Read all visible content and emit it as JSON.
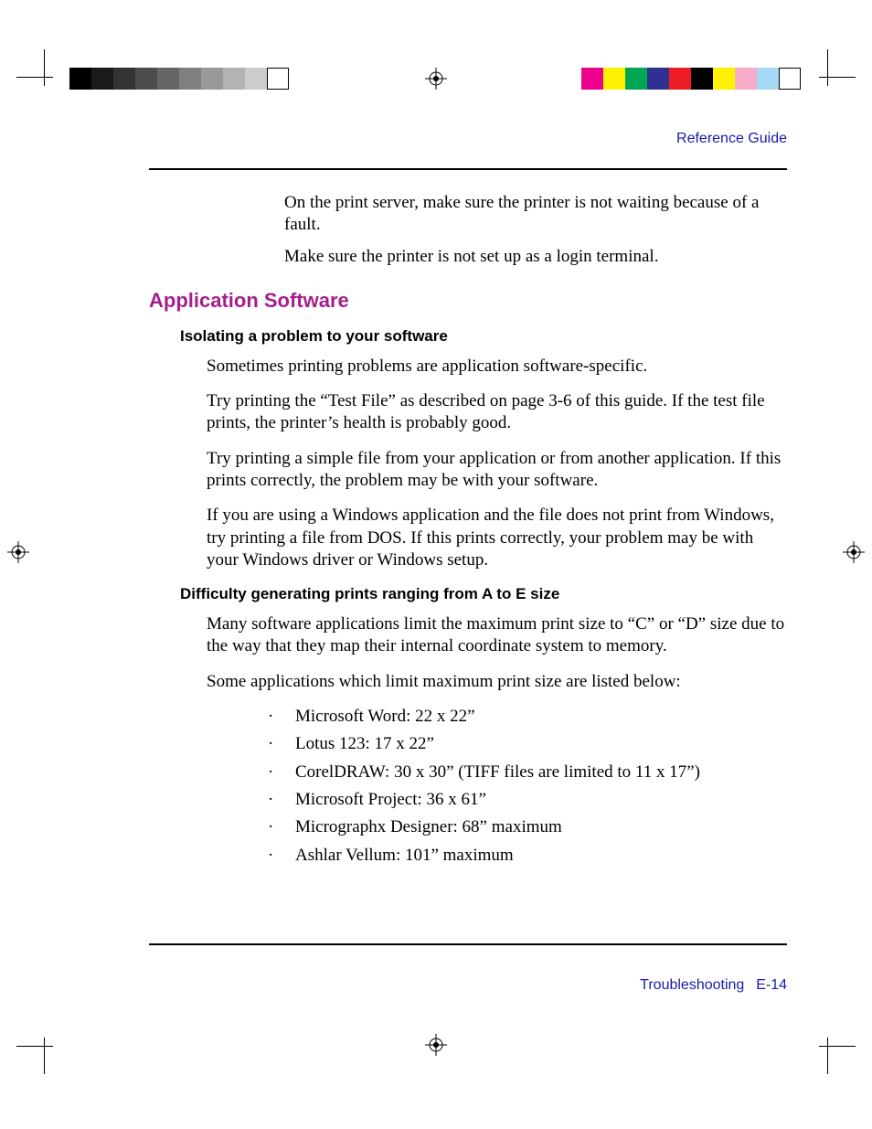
{
  "header": {
    "link": "Reference Guide"
  },
  "footer": {
    "section": "Troubleshooting",
    "page": "E-14"
  },
  "intro": {
    "line1": "On the print server, make sure the printer is not waiting because of a fault.",
    "line2": "Make sure the printer is not set up as a login terminal."
  },
  "section": {
    "title": "Application Software",
    "sub1": {
      "title": "Isolating a problem to your software",
      "p1": "Sometimes printing problems are application software-specific.",
      "p2": "Try printing the “Test File” as described on page 3-6 of this guide. If the test file prints, the printer’s health is probably good.",
      "p3": "Try printing a simple file from your application or from another application. If this prints correctly, the problem may be with your software.",
      "p4": "If you are using a Windows application and the file does not print from Windows, try printing a file from DOS. If this prints correctly, your problem may be with your Windows driver or Windows setup."
    },
    "sub2": {
      "title": "Difficulty generating prints ranging from A to E size",
      "p1": "Many software applications limit the maximum print size to “C” or “D” size due to the way that they map their internal coordinate system to memory.",
      "p2": "Some applications which limit maximum print size are listed below:",
      "items": [
        "Microsoft Word: 22 x 22”",
        "Lotus 123: 17 x 22”",
        "CorelDRAW: 30 x 30” (TIFF files are limited to 11 x 17”)",
        "Microsoft Project: 36 x 61”",
        "Micrographx Designer: 68” maximum",
        "Ashlar Vellum: 101” maximum"
      ]
    }
  },
  "colorbars": {
    "gray": [
      "#000000",
      "#1a1a1a",
      "#333333",
      "#4d4d4d",
      "#666666",
      "#808080",
      "#999999",
      "#b3b3b3",
      "#cccccc",
      "#ffffff"
    ],
    "color": [
      "#ec008c",
      "#fff200",
      "#00a651",
      "#2e3192",
      "#ed1c24",
      "#000000",
      "#fff200",
      "#f7adc9",
      "#a5d9f6",
      "#ffffff"
    ]
  }
}
